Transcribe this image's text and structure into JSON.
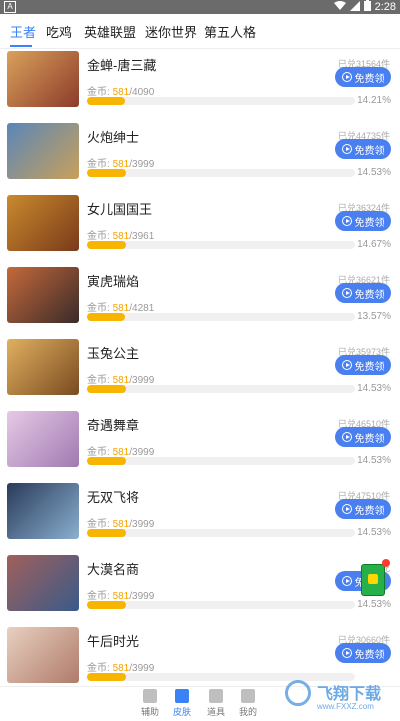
{
  "status_bar": {
    "left_badge": "A",
    "time": "2:28"
  },
  "tabs": [
    {
      "label": "王者",
      "active": true
    },
    {
      "label": "吃鸡",
      "active": false
    },
    {
      "label": "英雄联盟",
      "active": false
    },
    {
      "label": "迷你世界",
      "active": false
    },
    {
      "label": "第五人格",
      "active": false
    }
  ],
  "coin_label": "金币:",
  "button_label": "免费领",
  "items": [
    {
      "title": "金蝉-唐三藏",
      "exchanged": "已兑31564件",
      "current": "581",
      "total": "/4090",
      "percent": "14.21%",
      "progress": 14.21,
      "colors": [
        "#d9a15b",
        "#8c3b2a"
      ]
    },
    {
      "title": "火炮绅士",
      "exchanged": "已兑44735件",
      "current": "581",
      "total": "/3999",
      "percent": "14.53%",
      "progress": 14.53,
      "colors": [
        "#5a86b8",
        "#c9a05a"
      ]
    },
    {
      "title": "女儿国国王",
      "exchanged": "已兑36324件",
      "current": "581",
      "total": "/3961",
      "percent": "14.67%",
      "progress": 14.67,
      "colors": [
        "#c98a2e",
        "#7a3a1a"
      ]
    },
    {
      "title": "寅虎瑞焰",
      "exchanged": "已兑36621件",
      "current": "581",
      "total": "/4281",
      "percent": "13.57%",
      "progress": 13.57,
      "colors": [
        "#c46a3a",
        "#3a2a2a"
      ]
    },
    {
      "title": "玉兔公主",
      "exchanged": "已兑35973件",
      "current": "581",
      "total": "/3999",
      "percent": "14.53%",
      "progress": 14.53,
      "colors": [
        "#e0b060",
        "#7a4a20"
      ]
    },
    {
      "title": "奇遇舞章",
      "exchanged": "已兑46510件",
      "current": "581",
      "total": "/3999",
      "percent": "14.53%",
      "progress": 14.53,
      "colors": [
        "#e6c9e6",
        "#a07ab0"
      ]
    },
    {
      "title": "无双飞将",
      "exchanged": "已兑47510件",
      "current": "581",
      "total": "/3999",
      "percent": "14.53%",
      "progress": 14.53,
      "colors": [
        "#2a3a5a",
        "#8ab0d0"
      ]
    },
    {
      "title": "大漠名商",
      "exchanged": "已兑",
      "current": "581",
      "total": "/3999",
      "percent": "14.53%",
      "progress": 14.53,
      "colors": [
        "#a0605a",
        "#3a5a8a"
      ]
    },
    {
      "title": "午后时光",
      "exchanged": "已兑30660件",
      "current": "581",
      "total": "/3999",
      "percent": "",
      "progress": 14.53,
      "colors": [
        "#e8d0c0",
        "#b07a6a"
      ]
    }
  ],
  "bottom_nav": [
    {
      "label": "辅助",
      "active": false
    },
    {
      "label": "皮肤",
      "active": true
    },
    {
      "label": "道具",
      "active": false
    },
    {
      "label": "我的",
      "active": false
    }
  ],
  "watermark": {
    "text": "飞翔下载",
    "url": "www.FXXZ.com"
  }
}
